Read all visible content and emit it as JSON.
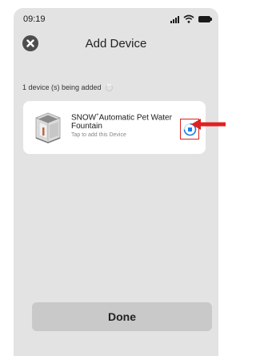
{
  "status_bar": {
    "time": "09:19"
  },
  "header": {
    "title": "Add Device",
    "close_icon": "close-circle-icon"
  },
  "adding_status": {
    "text": "1 device (s) being added"
  },
  "device": {
    "name_prefix": "SNOW",
    "name_mark": "+",
    "name_suffix": "Automatic Pet Water Fountain",
    "hint": "Tap to add this Device",
    "image_icon": "pet-fountain-icon",
    "action_icon": "add-progress-icon"
  },
  "colors": {
    "screen_background": "#e3e3e3",
    "card_background": "#ffffff",
    "accent_blue": "#1e7fe6",
    "highlight_red": "#e02020",
    "done_button": "#c9c9c9"
  },
  "done": {
    "label": "Done"
  }
}
